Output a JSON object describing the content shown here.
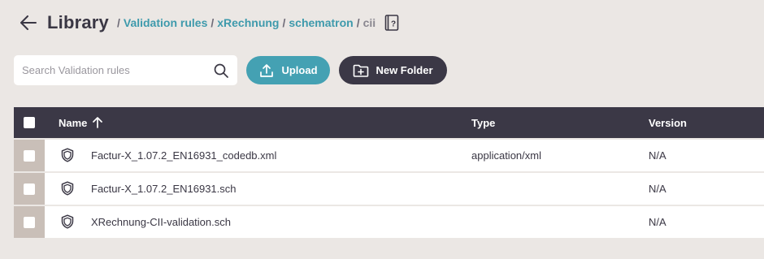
{
  "header": {
    "title": "Library",
    "breadcrumbs": [
      {
        "label": "Validation rules",
        "link": true
      },
      {
        "label": "xRechnung",
        "link": true
      },
      {
        "label": "schematron",
        "link": true
      },
      {
        "label": "cii",
        "link": false
      }
    ],
    "separator": "/"
  },
  "toolbar": {
    "search_placeholder": "Search Validation rules",
    "upload_label": "Upload",
    "new_folder_label": "New Folder"
  },
  "table": {
    "columns": {
      "name": "Name",
      "type": "Type",
      "version": "Version"
    },
    "rows": [
      {
        "name": "Factur-X_1.07.2_EN16931_codedb.xml",
        "type": "application/xml",
        "version": "N/A"
      },
      {
        "name": "Factur-X_1.07.2_EN16931.sch",
        "type": "",
        "version": "N/A"
      },
      {
        "name": "XRechnung-CII-validation.sch",
        "type": "",
        "version": "N/A"
      }
    ]
  },
  "colors": {
    "background": "#ebe7e4",
    "accent": "#44a1b3",
    "link": "#3e9aac",
    "dark": "#3b3846"
  },
  "icons": {
    "back": "arrow-left-icon",
    "help": "help-book-icon",
    "search": "search-icon",
    "upload": "upload-icon",
    "new_folder": "folder-plus-icon",
    "sort": "arrow-up-icon",
    "row": "shield-icon"
  }
}
